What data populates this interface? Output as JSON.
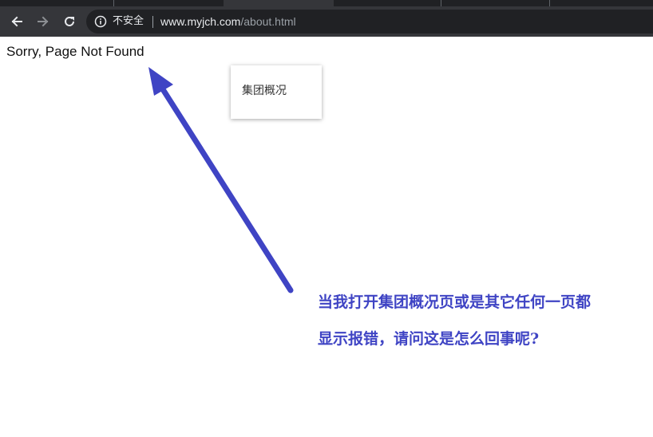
{
  "browser": {
    "security_label": "不安全",
    "url_host": "www.myjch.com",
    "url_path": "/about.html"
  },
  "page": {
    "error_message": "Sorry, Page Not Found",
    "dropdown": {
      "item_label": "集团概况"
    }
  },
  "annotation": {
    "line1": "当我打开集团概况页或是其它任何一页都",
    "line2": "显示报错，请问这是怎么回事呢?",
    "color": "#3f44c4"
  },
  "colors": {
    "chrome_dark": "#202124",
    "toolbar": "#35363a"
  }
}
